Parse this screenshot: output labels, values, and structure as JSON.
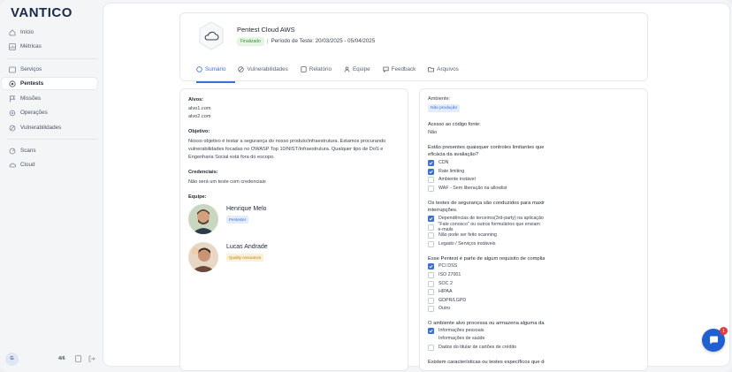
{
  "app": {
    "logo": "VANTICO"
  },
  "sidebar": {
    "items": [
      {
        "label": "Início",
        "icon": "home-icon"
      },
      {
        "label": "Métricas",
        "icon": "chart-icon"
      },
      {
        "label": "Serviços",
        "icon": "shield-icon"
      },
      {
        "label": "Pentests",
        "icon": "target-icon",
        "active": true
      },
      {
        "label": "Missões",
        "icon": "flag-icon"
      },
      {
        "label": "Operações",
        "icon": "gear-icon"
      },
      {
        "label": "Vulnerabilidades",
        "icon": "bug-icon"
      },
      {
        "label": "Scans",
        "icon": "radar-icon"
      },
      {
        "label": "Cloud",
        "icon": "cloud-icon"
      }
    ],
    "footer": {
      "avatar_initial": "G",
      "count": "4/6"
    }
  },
  "project": {
    "title": "Pentest Cloud AWS",
    "status": "Finalizado",
    "period": "Período de Teste: 20/03/2025 - 05/04/2025"
  },
  "tabs": [
    {
      "label": "Sumário",
      "active": true
    },
    {
      "label": "Vulnerabilidades"
    },
    {
      "label": "Relatório"
    },
    {
      "label": "Equipe"
    },
    {
      "label": "Feedback"
    },
    {
      "label": "Arquivos"
    }
  ],
  "summary": {
    "targets_label": "Alvos:",
    "targets": [
      "alvo1.com",
      "alvo2.com"
    ],
    "objective_label": "Objetivo:",
    "objective_lines": [
      "Nosso objetivo é testar a segurança do nosso produto/infraestrutura. Estamos procurando",
      "vulnerabilidades focadas no OWASP Top 10/NIST/Infraestrutura. Qualquer tipo de DoS e",
      "Engenharia Social está fora do escopo."
    ],
    "credentials_label": "Credenciais:",
    "credentials": "Não será um teste com credenciais",
    "team_label": "Equipe:",
    "team": [
      {
        "name": "Henrique Melo",
        "role": "Pentester",
        "role_color": "#3b6fd6",
        "role_bg": "#e3ecfb"
      },
      {
        "name": "Lucas Andrade",
        "role": "Quality Assurance",
        "role_color": "#b87a12",
        "role_bg": "#fcf0d6"
      }
    ]
  },
  "questionnaire": {
    "environment_label": "Ambiente:",
    "environment": "Não produção",
    "source_label": "Acesso ao código fonte:",
    "source": "Não",
    "q1": "Estão presentes quaisquer controles limitantes que possam afetar o desempenho ou a eficácia da avaliação?",
    "q1_options": [
      {
        "label": "CDN",
        "checked": true
      },
      {
        "label": "Rate limiting",
        "checked": true
      },
      {
        "label": "Ambiente instável",
        "checked": false
      },
      {
        "label": "WAF - Sem liberação na allowlist",
        "checked": false
      }
    ],
    "q2": "Os testes de segurança são conduzidos para maximizar a eficácia e minimizar quaisquer interrupções.",
    "q2_options": [
      {
        "label": "Dependências de terceiros(3rd-party) na aplicação",
        "checked": true
      },
      {
        "label": "\"Fale conosco\" ou outros formulários que enviam e-mails",
        "checked": false
      },
      {
        "label": "Não pode ser feito scanning",
        "checked": false
      },
      {
        "label": "Legado / Serviços instáveis",
        "checked": false
      }
    ],
    "q3": "Esse Pentest é parte de algum requisito de compliance?",
    "q3_options": [
      {
        "label": "PCI DSS",
        "checked": true
      },
      {
        "label": "ISO 27001",
        "checked": false
      },
      {
        "label": "SOC 2",
        "checked": false
      },
      {
        "label": "HIPAA",
        "checked": false
      },
      {
        "label": "GDPR/LGPD",
        "checked": false
      },
      {
        "label": "Outro",
        "checked": false
      }
    ],
    "q4": "O ambiente alvo processa ou armazena alguma das informações abaixo?",
    "q4_options": [
      {
        "label": "Informações pessoais",
        "checked": true
      },
      {
        "label": "Informações de saúde",
        "checked": false
      },
      {
        "label": "Dados do titular de cartões de crédito",
        "checked": false
      }
    ],
    "q5": "Existem características ou testes específicos que devem ser excluídos da avaliação?"
  },
  "chat": {
    "badge": "1"
  },
  "colors": {
    "accent": "#3b6fd6",
    "chat": "#1f5fd1",
    "success": "#3c8b3c"
  }
}
